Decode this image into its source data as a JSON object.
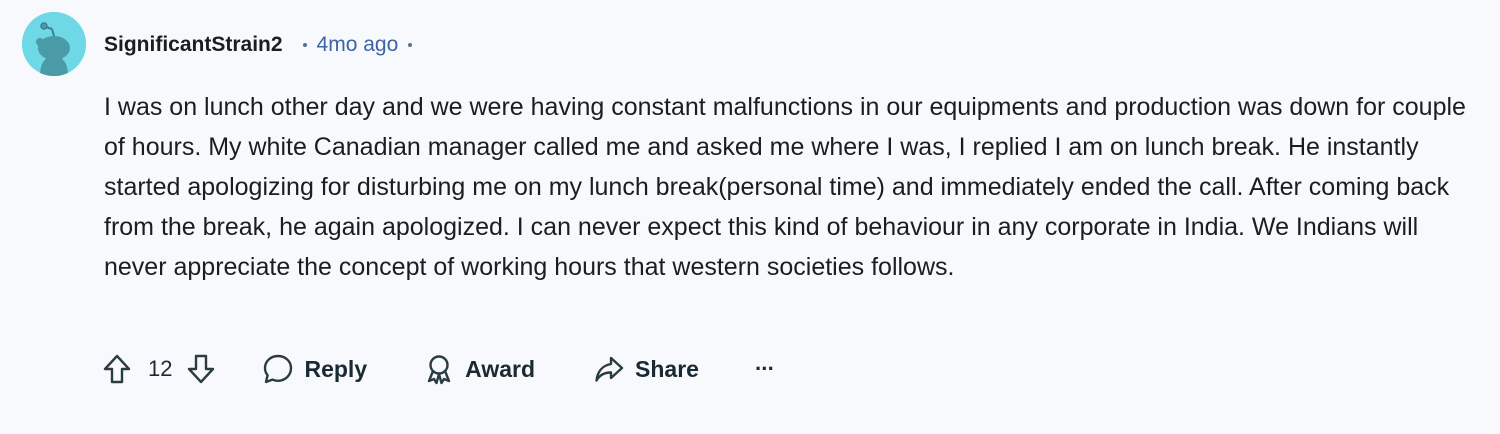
{
  "comment": {
    "author": "SignificantStrain2",
    "timestamp": "4mo ago",
    "body": "I was on lunch other day and we were having constant malfunctions in our equipments and production was down for couple of hours. My white Canadian manager called me and asked me where I was, I replied I am on lunch break. He instantly started apologizing for disturbing me on my lunch break(personal time) and immediately ended the call. After coming back from the break, he again apologized. I can never expect this kind of behaviour in any corporate in India. We Indians will never appreciate the concept of working hours that western societies follows.",
    "votes": "12"
  },
  "actions": {
    "reply_label": "Reply",
    "award_label": "Award",
    "share_label": "Share",
    "more_label": "···"
  },
  "colors": {
    "background": "#f8f9fc",
    "avatar_bg": "#6fd8e6",
    "timestamp": "#3d63a6",
    "text": "#1a1d21"
  },
  "icons": {
    "avatar": "snoo-avatar-icon",
    "upvote": "upvote-arrow-icon",
    "downvote": "downvote-arrow-icon",
    "reply": "speech-bubble-icon",
    "award": "award-ribbon-icon",
    "share": "share-arrow-icon",
    "more": "ellipsis-icon"
  }
}
